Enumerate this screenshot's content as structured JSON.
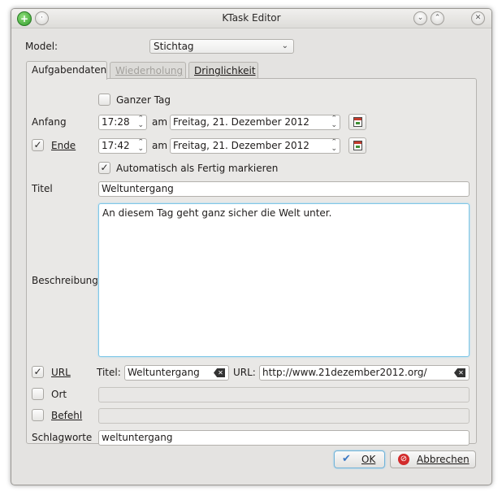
{
  "window": {
    "title": "KTask Editor"
  },
  "model": {
    "label": "Model:",
    "value": "Stichtag"
  },
  "tabs": [
    {
      "label": "Aufgabendaten",
      "state": "active"
    },
    {
      "label": "Wiederholung",
      "state": "disabled"
    },
    {
      "label": "Dringlichkeit",
      "state": "normal"
    }
  ],
  "form": {
    "ganzer_tag": {
      "label": "Ganzer Tag",
      "checked": false
    },
    "anfang": {
      "label": "Anfang",
      "time": "17:28",
      "am": "am",
      "date": "Freitag, 21. Dezember 2012"
    },
    "ende": {
      "label": "Ende",
      "checked": true,
      "time": "17:42",
      "am": "am",
      "date": "Freitag, 21. Dezember 2012"
    },
    "auto_fertig": {
      "label": "Automatisch als Fertig markieren",
      "checked": true
    },
    "titel": {
      "label": "Titel",
      "value": "Weltuntergang"
    },
    "beschreibung": {
      "label": "Beschreibung",
      "value": "An diesem Tag geht ganz sicher die Welt unter."
    },
    "url": {
      "label": "URL",
      "checked": true,
      "titel_label": "Titel:",
      "titel_value": "Weltuntergang",
      "url_label": "URL:",
      "url_value": "http://www.21dezember2012.org/"
    },
    "ort": {
      "label": "Ort",
      "checked": false,
      "value": ""
    },
    "befehl": {
      "label": "Befehl",
      "checked": false,
      "value": ""
    },
    "schlagworte": {
      "label": "Schlagworte",
      "value": "weltuntergang"
    }
  },
  "buttons": {
    "ok": "OK",
    "abbrechen": "Abbrechen"
  },
  "icons": {
    "app": "ktask-app-icon",
    "minimize": "minimize-icon",
    "maximize": "maximize-icon",
    "close": "close-icon",
    "calendar": "calendar-icon",
    "ok": "checkmark-icon",
    "cancel": "cancel-icon",
    "clear": "clear-field-icon"
  },
  "colors": {
    "focus": "#7fc7e8",
    "cancel": "#d22b2b",
    "ok": "#3b78c4"
  }
}
